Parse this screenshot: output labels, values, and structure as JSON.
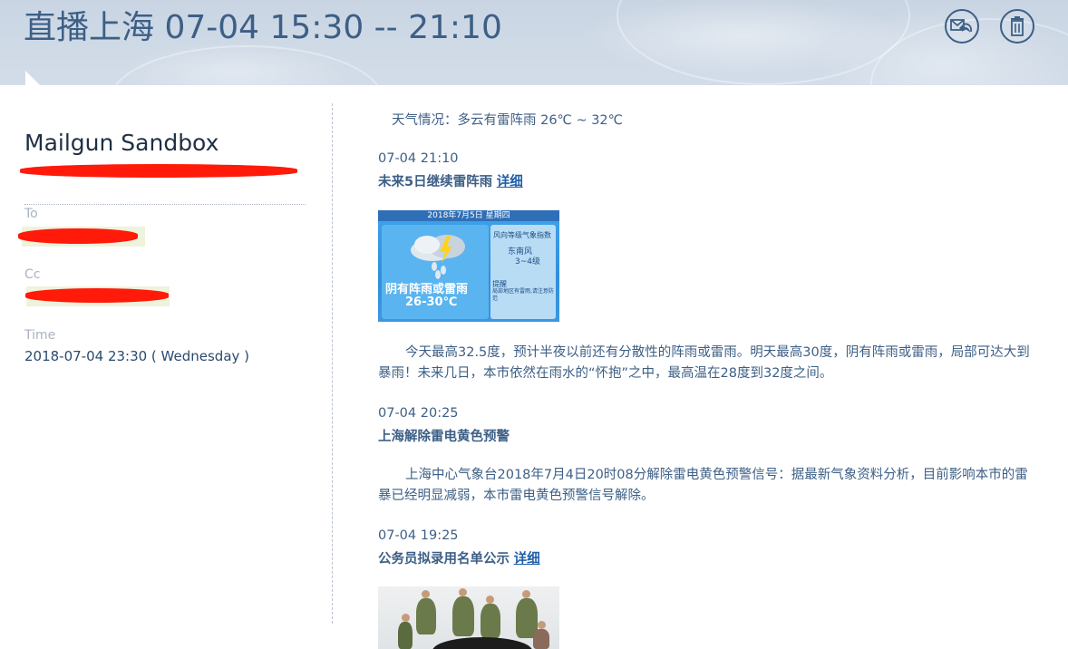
{
  "header": {
    "title": "直播上海 07-04 15:30 -- 21:10",
    "reply_button": "reply-all",
    "delete_button": "delete"
  },
  "message": {
    "sender_name": "Mailgun Sandbox",
    "to_label": "To",
    "cc_label": "Cc",
    "time_label": "Time",
    "time_value": "2018-07-04 23:30 ( Wednesday )"
  },
  "body": {
    "weather_summary": "天气情况：多云有雷阵雨 26℃ ~ 32℃",
    "items": [
      {
        "timestamp": "07-04 21:10",
        "headline": "未来5日继续雷阵雨",
        "link": "详细",
        "image": {
          "date": "2018年7月5日 星期四",
          "condition": "阴有阵雨或雷雨",
          "temp": "26-30℃",
          "wind_title": "风向等级气象指数",
          "wind_dir": "东南风",
          "wind_level": "3~4级",
          "tip_title": "提醒",
          "tip_text": "局部地区有雷雨,请注意防范"
        },
        "paragraph": "今天最高32.5度，预计半夜以前还有分散性的阵雨或雷雨。明天最高30度，阴有阵雨或雷雨，局部可达大到暴雨！未来几日，本市依然在雨水的“怀抱”之中，最高温在28度到32度之间。"
      },
      {
        "timestamp": "07-04 20:25",
        "headline": "上海解除雷电黄色预警",
        "paragraph": "上海中心气象台2018年7月4日20时08分解除雷电黄色预警信号：据最新气象资料分析，目前影响本市的雷暴已经明显减弱，本市雷电黄色预警信号解除。"
      },
      {
        "timestamp": "07-04 19:25",
        "headline": "公务员拟录用名单公示",
        "link": "详细"
      }
    ]
  },
  "colors": {
    "title": "#3d5f86",
    "text": "#3d5f86",
    "link": "#1f5fa8",
    "redaction": "#ff1a0a",
    "header_bg": "#cbd6e4"
  }
}
